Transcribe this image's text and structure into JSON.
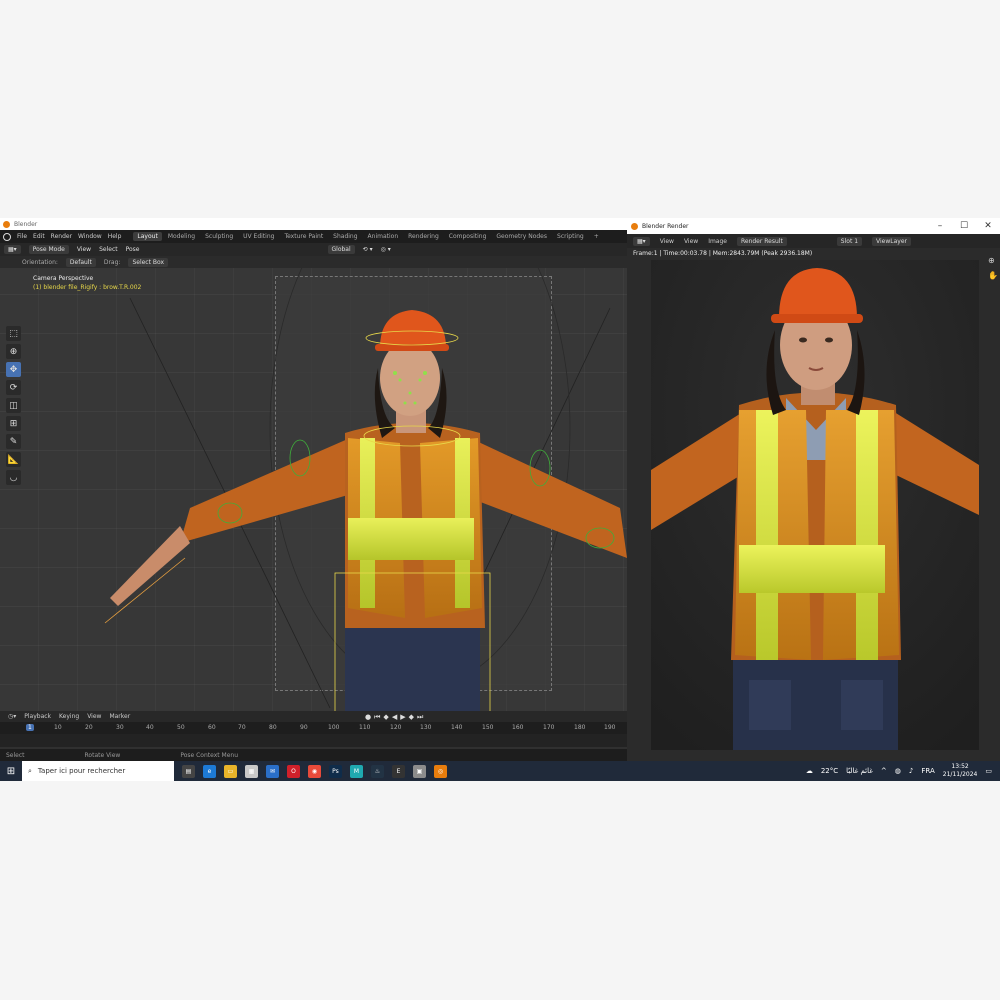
{
  "blender": {
    "title": "Blender",
    "menu": [
      "File",
      "Edit",
      "Render",
      "Window",
      "Help"
    ],
    "tabs": [
      "Layout",
      "Modeling",
      "Sculpting",
      "UV Editing",
      "Texture Paint",
      "Shading",
      "Animation",
      "Rendering",
      "Compositing",
      "Geometry Nodes",
      "Scripting"
    ],
    "active_tab": "Layout",
    "header": {
      "mode": "Pose Mode",
      "items": [
        "View",
        "Select",
        "Pose"
      ],
      "transform": "Global"
    },
    "tool_settings": {
      "orientation_label": "Orientation:",
      "orientation_value": "Default",
      "drag_label": "Drag:",
      "drag_value": "Select Box"
    },
    "viewport": {
      "camera_label": "Camera Perspective",
      "selection_label": "(1) blender file_Rigify : brow.T.R.002"
    },
    "timeline": {
      "menu": [
        "Playback",
        "Keying",
        "View",
        "Marker"
      ],
      "current_frame": "1",
      "ticks": [
        "10",
        "20",
        "30",
        "40",
        "50",
        "60",
        "70",
        "80",
        "90",
        "100",
        "110",
        "120",
        "130",
        "140",
        "150",
        "160",
        "170",
        "180",
        "190"
      ]
    },
    "status": [
      "Select",
      "Rotate View",
      "Pose Context Menu"
    ]
  },
  "render": {
    "title": "Blender Render",
    "header": [
      "View",
      "View",
      "Image"
    ],
    "result": "Render Result",
    "slot": "Slot 1",
    "layer": "ViewLayer",
    "info": "Frame:1 | Time:00:03.78 | Mem:2843.79M (Peak 2936.18M)"
  },
  "taskbar": {
    "search_placeholder": "Taper ici pour rechercher",
    "weather": "22°C",
    "weather_text": "غائم غالبًا",
    "lang": "FRA",
    "time": "13:52",
    "date": "21/11/2024"
  },
  "colors": {
    "vest_yellow": "#d4e23a",
    "vest_orange": "#d98a1a",
    "helmet": "#e0561c",
    "jacket": "#c86a25",
    "accent": "#4772b3"
  }
}
